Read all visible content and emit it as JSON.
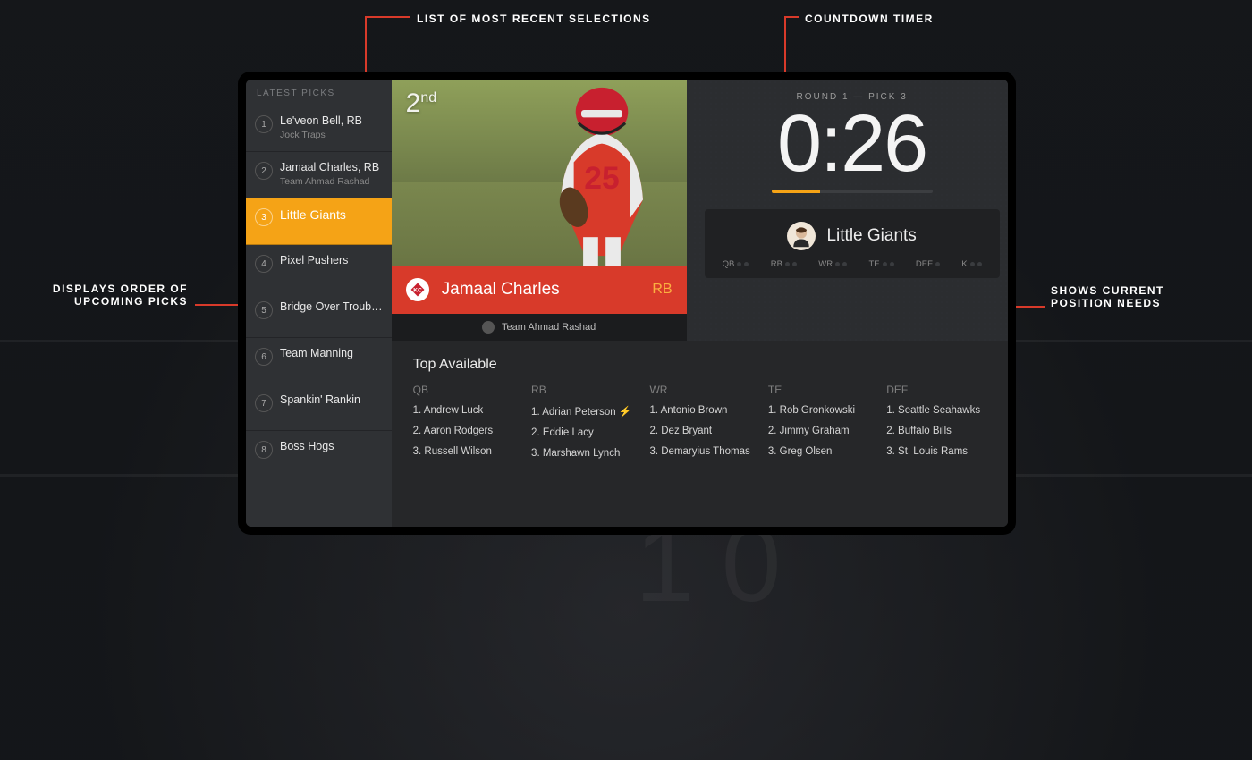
{
  "callouts": {
    "recent": "LIST OF MOST RECENT SELECTIONS",
    "timer": "COUNTDOWN TIMER",
    "upcoming1": "DISPLAYS ORDER OF",
    "upcoming2": "UPCOMING PICKS",
    "needs1": "SHOWS CURRENT",
    "needs2": "POSITION NEEDS"
  },
  "sidebar": {
    "header": "LATEST PICKS",
    "items": [
      {
        "num": "1",
        "name": "Le'veon Bell, RB",
        "sub": "Jock Traps"
      },
      {
        "num": "2",
        "name": "Jamaal Charles, RB",
        "sub": "Team Ahmad Rashad"
      },
      {
        "num": "3",
        "name": "Little Giants",
        "sub": ""
      },
      {
        "num": "4",
        "name": "Pixel Pushers",
        "sub": ""
      },
      {
        "num": "5",
        "name": "Bridge Over Troub…",
        "sub": ""
      },
      {
        "num": "6",
        "name": "Team Manning",
        "sub": ""
      },
      {
        "num": "7",
        "name": "Spankin' Rankin",
        "sub": ""
      },
      {
        "num": "8",
        "name": "Boss Hogs",
        "sub": ""
      }
    ]
  },
  "player": {
    "ordinal_num": "2",
    "ordinal_suffix": "nd",
    "name": "Jamaal Charles",
    "position": "RB",
    "owner": "Team Ahmad Rashad"
  },
  "timer": {
    "round_label": "ROUND 1 — PICK 3",
    "value": "0:26"
  },
  "team": {
    "name": "Little Giants",
    "positions": [
      "QB",
      "RB",
      "WR",
      "TE",
      "DEF",
      "K"
    ]
  },
  "available": {
    "title": "Top Available",
    "columns": [
      {
        "hdr": "QB",
        "rows": [
          "1. Andrew Luck",
          "2. Aaron Rodgers",
          "3. Russell Wilson"
        ]
      },
      {
        "hdr": "RB",
        "rows": [
          "1. Adrian Peterson ⚡",
          "2. Eddie Lacy",
          "3. Marshawn Lynch"
        ]
      },
      {
        "hdr": "WR",
        "rows": [
          "1. Antonio Brown",
          "2. Dez Bryant",
          "3. Demaryius Thomas"
        ]
      },
      {
        "hdr": "TE",
        "rows": [
          "1. Rob Gronkowski",
          "2. Jimmy Graham",
          "3. Greg Olsen"
        ]
      },
      {
        "hdr": "DEF",
        "rows": [
          "1. Seattle Seahawks",
          "2. Buffalo Bills",
          "3. St. Louis Rams"
        ]
      }
    ]
  }
}
